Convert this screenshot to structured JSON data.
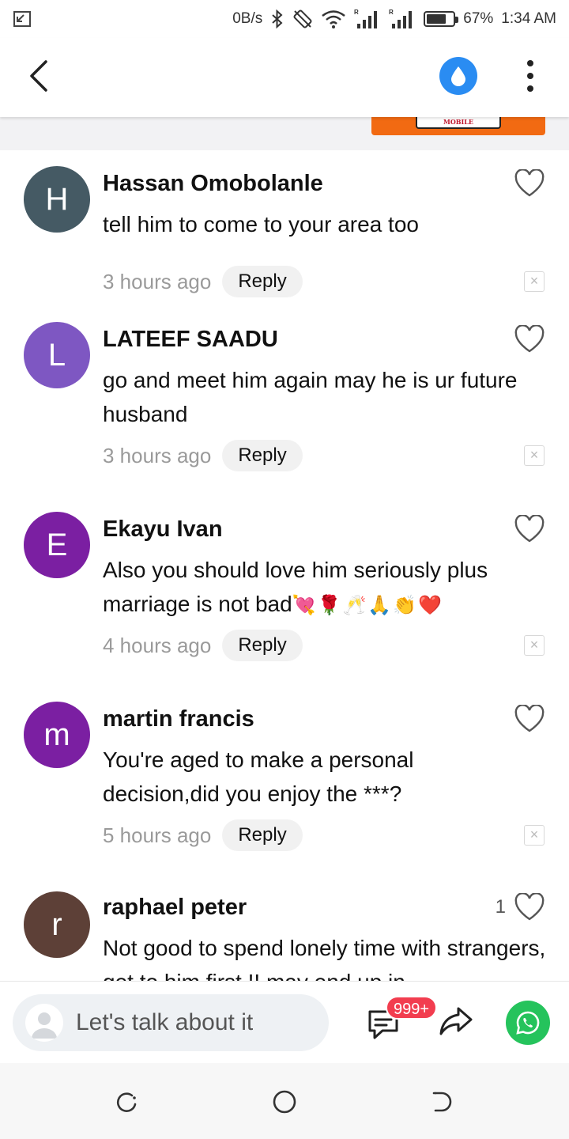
{
  "status_bar": {
    "net_speed": "0B/s",
    "battery": "67%",
    "time": "1:34 AM",
    "signal_tag_1": "R",
    "signal_tag_2": "R"
  },
  "app_bar": {
    "back_icon": "chevron-left-icon",
    "drop_icon": "water-drop-icon",
    "more_icon": "more-vertical-icon"
  },
  "ad": {
    "text": "MOBILE",
    "color": "#f26a12"
  },
  "comments": [
    {
      "initial": "H",
      "avatar_color": "#455a64",
      "author": "Hassan Omobolanle",
      "text": "tell him to come to your area too",
      "time": "3 hours ago",
      "reply_label": "Reply",
      "likes": ""
    },
    {
      "initial": "L",
      "avatar_color": "#7e57c2",
      "author": "LATEEF SAADU",
      "text": "go and meet him again may he is ur future husband",
      "time": "3 hours ago",
      "reply_label": "Reply",
      "likes": ""
    },
    {
      "initial": "E",
      "avatar_color": "#7b1fa2",
      "author": "Ekayu Ivan",
      "text": "Also you should love him seriously plus marriage is not bad",
      "emoji": "💘🌹🥂🙏👏❤️",
      "time": "4 hours ago",
      "reply_label": "Reply",
      "likes": ""
    },
    {
      "initial": "m",
      "avatar_color": "#7b1fa2",
      "author": "martin francis",
      "text": "You're aged to make a personal decision,did you enjoy the ***?",
      "time": "5 hours ago",
      "reply_label": "Reply",
      "likes": ""
    },
    {
      "initial": "r",
      "avatar_color": "#5d4037",
      "author": "raphael peter",
      "text": "Not good to spend lonely time with strangers, get to him first !! may end up in",
      "time": "",
      "reply_label": "",
      "likes": "1"
    }
  ],
  "bottom_bar": {
    "input_placeholder": "Let's talk about it",
    "badge": "999+",
    "comment_icon": "comment-icon",
    "share_icon": "share-icon",
    "whatsapp_icon": "whatsapp-icon"
  },
  "nav_bar": {
    "recent_icon": "recent-apps-icon",
    "home_icon": "home-icon",
    "back_icon": "back-icon"
  }
}
